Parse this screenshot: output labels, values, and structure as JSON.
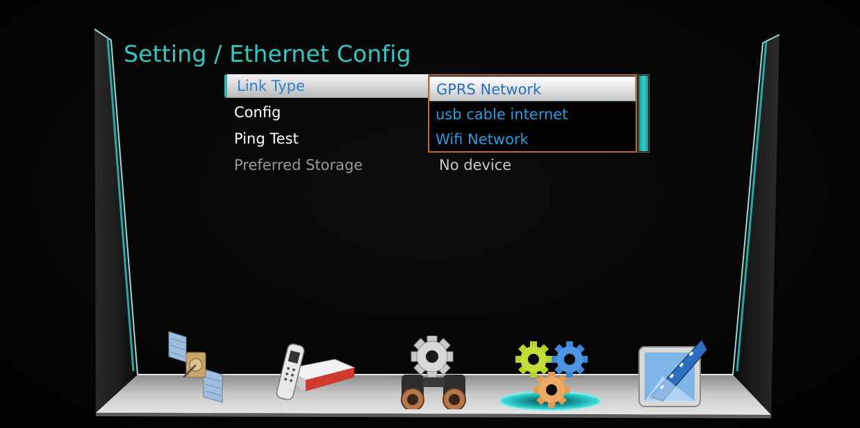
{
  "header": {
    "title": "Setting / Ethernet Config"
  },
  "menu": {
    "items": [
      {
        "label": "Link Type",
        "state": "selected"
      },
      {
        "label": "Config",
        "state": "normal"
      },
      {
        "label": "Ping Test",
        "state": "normal"
      },
      {
        "label": "Preferred Storage",
        "state": "disabled"
      }
    ]
  },
  "values": {
    "preferred_storage": "No device"
  },
  "link_type_dropdown": {
    "options": [
      "GPRS Network",
      "usb cable internet",
      "Wifi Network"
    ],
    "selected": "GPRS Network"
  },
  "shelf_icons": [
    {
      "name": "satellite-icon"
    },
    {
      "name": "remote-receiver-icon"
    },
    {
      "name": "binoculars-gear-icon"
    },
    {
      "name": "gears-icon",
      "selected": true
    },
    {
      "name": "media-film-icon"
    }
  ],
  "colors": {
    "accent": "#33c9c3",
    "highlight_text": "#2d7fc9",
    "option_text": "#2d9be0",
    "dropdown_border": "#c06a2c"
  }
}
